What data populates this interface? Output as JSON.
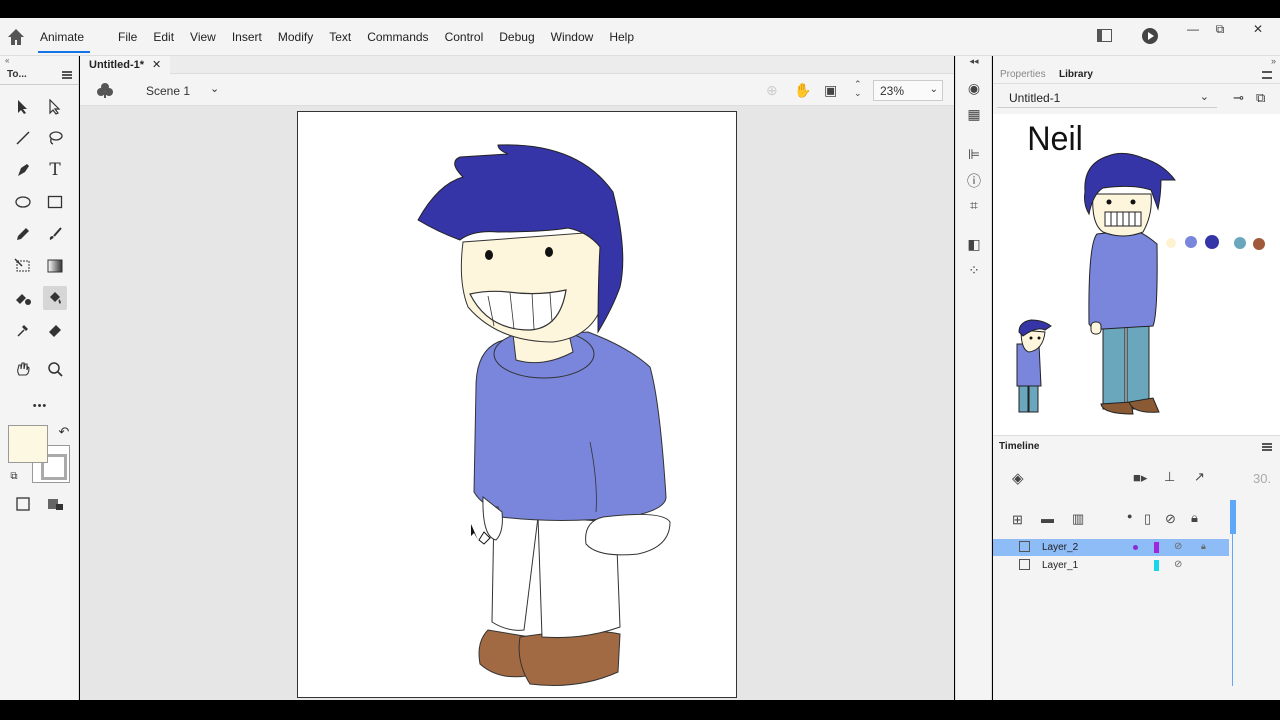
{
  "app": {
    "name": "Animate",
    "menu": [
      "File",
      "Edit",
      "View",
      "Insert",
      "Modify",
      "Text",
      "Commands",
      "Control",
      "Debug",
      "Window",
      "Help"
    ],
    "window_controls": [
      "—",
      "⧉",
      "✕"
    ]
  },
  "tools_panel": {
    "title": "To...",
    "collapse": "«",
    "more": "•••"
  },
  "document": {
    "tab_title": "Untitled-1*",
    "tab_close": "✕",
    "scene": "Scene 1",
    "zoom": "23%"
  },
  "colors": {
    "fill": "#fdf8e2",
    "stroke": "#aaaaaa",
    "accent": "#1473e6",
    "selected_layer": "#8ebcf6",
    "hair": "#3535a8",
    "sweater": "#7986dc",
    "pants": "#ffffff",
    "shoes": "#a26a43",
    "skin": "#fdf6dc"
  },
  "right_panel": {
    "collapse": "»",
    "tabs": [
      "Properties",
      "Library"
    ],
    "active_tab": "Library",
    "library_select": "Untitled-1",
    "preview_text": "Neil",
    "palette": [
      "#fdf3d0",
      "#7986dc",
      "#3535a8",
      "#6aa7bd",
      "#a0593a"
    ]
  },
  "timeline": {
    "title": "Timeline",
    "frame_label": "30.",
    "layers": [
      {
        "name": "Layer_2",
        "color": "#a025e0",
        "selected": true
      },
      {
        "name": "Layer_1",
        "color": "#18d6e6",
        "selected": false
      }
    ]
  }
}
